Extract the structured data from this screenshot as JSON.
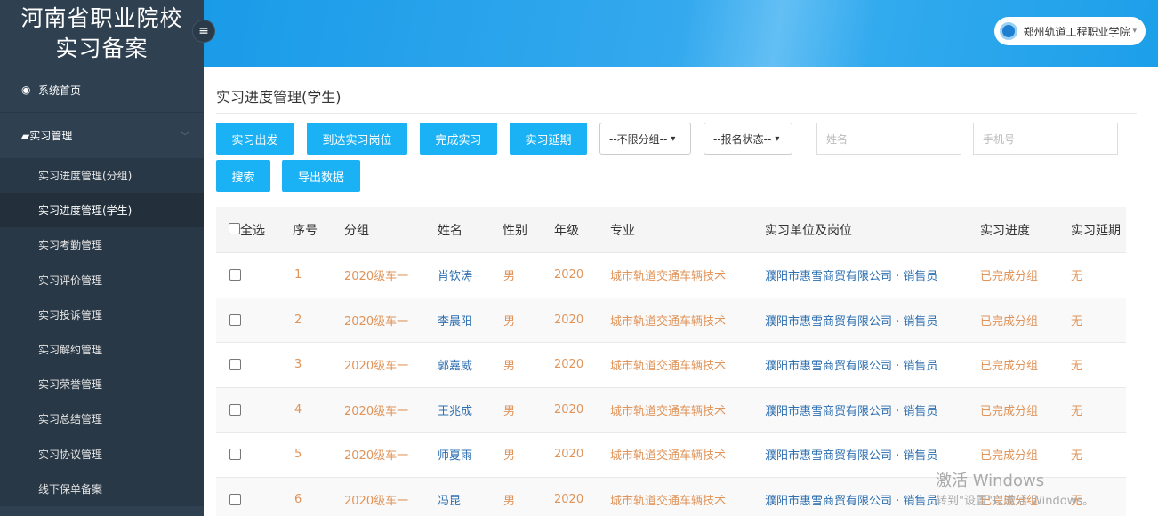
{
  "sidebar": {
    "brand_line1": "河南省职业院校",
    "brand_line2": "实习备案",
    "home": "系统首页",
    "group": "实习管理",
    "items": [
      "实习进度管理(分组)",
      "实习进度管理(学生)",
      "实习考勤管理",
      "实习评价管理",
      "实习投诉管理",
      "实习解约管理",
      "实习荣誉管理",
      "实习总结管理",
      "实习协议管理",
      "线下保单备案"
    ],
    "active_index": 1
  },
  "header": {
    "school": "郑州轨道工程职业学院"
  },
  "main": {
    "title": "实习进度管理(学生)",
    "buttons": {
      "depart": "实习出发",
      "arrive": "到达实习岗位",
      "complete": "完成实习",
      "extend": "实习延期",
      "search": "搜索",
      "export": "导出数据"
    },
    "group_select": "--不限分组--",
    "status_select": "--报名状态--",
    "name_placeholder": "姓名",
    "phone_placeholder": "手机号"
  },
  "table": {
    "headers": {
      "select_all": "全选",
      "index": "序号",
      "group": "分组",
      "name": "姓名",
      "gender": "性别",
      "grade": "年级",
      "major": "专业",
      "unit": "实习单位及岗位",
      "progress": "实习进度",
      "delay": "实习延期"
    },
    "rows": [
      {
        "index": "1",
        "group": "2020级车一",
        "name": "肖钦涛",
        "gender": "男",
        "grade": "2020",
        "major": "城市轨道交通车辆技术",
        "unit": "濮阳市惠雪商贸有限公司 · 销售员",
        "progress": "已完成分组",
        "delay": "无"
      },
      {
        "index": "2",
        "group": "2020级车一",
        "name": "李晨阳",
        "gender": "男",
        "grade": "2020",
        "major": "城市轨道交通车辆技术",
        "unit": "濮阳市惠雪商贸有限公司 · 销售员",
        "progress": "已完成分组",
        "delay": "无"
      },
      {
        "index": "3",
        "group": "2020级车一",
        "name": "郭嘉威",
        "gender": "男",
        "grade": "2020",
        "major": "城市轨道交通车辆技术",
        "unit": "濮阳市惠雪商贸有限公司 · 销售员",
        "progress": "已完成分组",
        "delay": "无"
      },
      {
        "index": "4",
        "group": "2020级车一",
        "name": "王兆成",
        "gender": "男",
        "grade": "2020",
        "major": "城市轨道交通车辆技术",
        "unit": "濮阳市惠雪商贸有限公司 · 销售员",
        "progress": "已完成分组",
        "delay": "无"
      },
      {
        "index": "5",
        "group": "2020级车一",
        "name": "师夏雨",
        "gender": "男",
        "grade": "2020",
        "major": "城市轨道交通车辆技术",
        "unit": "濮阳市惠雪商贸有限公司 · 销售员",
        "progress": "已完成分组",
        "delay": "无"
      },
      {
        "index": "6",
        "group": "2020级车一",
        "name": "冯昆",
        "gender": "男",
        "grade": "2020",
        "major": "城市轨道交通车辆技术",
        "unit": "濮阳市惠雪商贸有限公司 · 销售员",
        "progress": "已完成分组",
        "delay": "无"
      }
    ]
  },
  "watermark": {
    "line1": "激活 Windows",
    "line2": "转到\"设置\"以激活 Windows。"
  },
  "colors": {
    "sidebar_bg": "#2f4050",
    "accent": "#1ab1f5",
    "orange_text": "#e0945a",
    "blue_text": "#2e6fb0"
  }
}
